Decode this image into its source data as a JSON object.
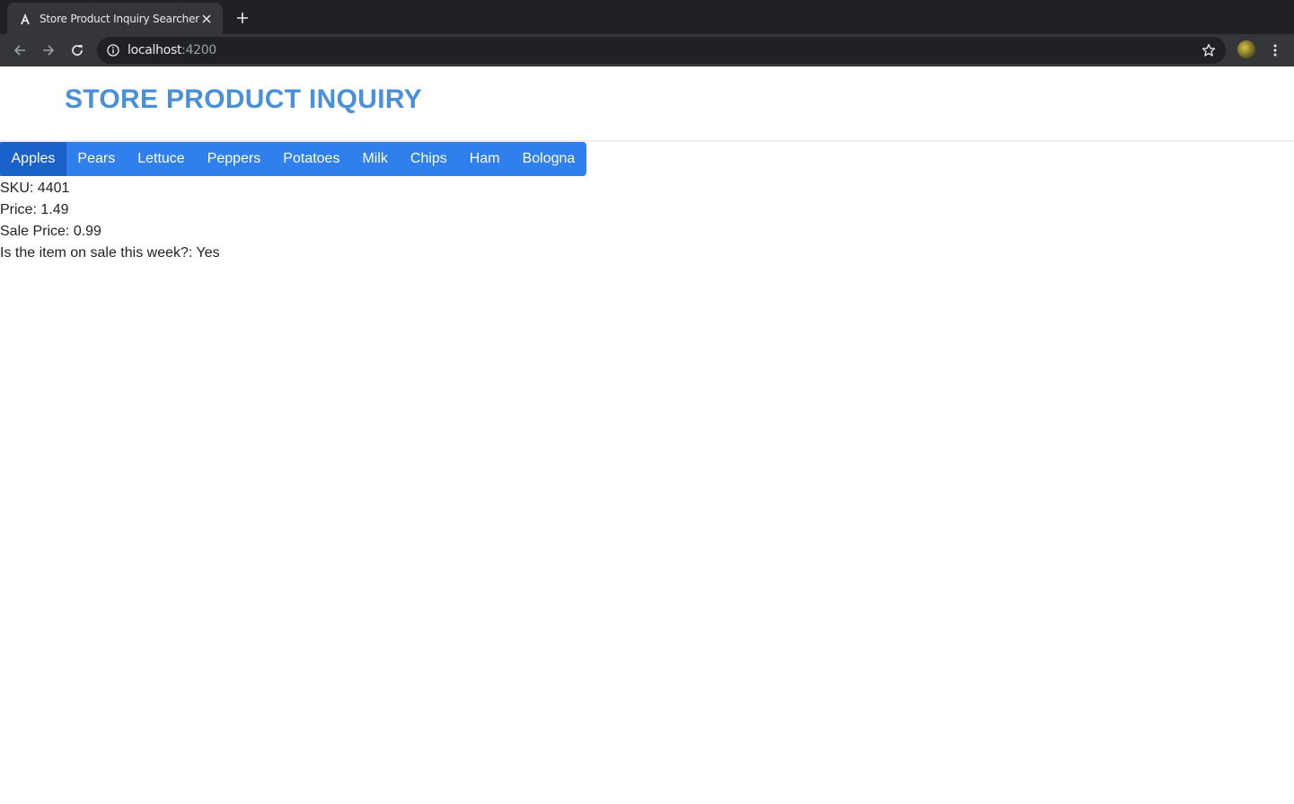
{
  "browser": {
    "tab_title": "Store Product Inquiry Searcher",
    "url_host": "localhost",
    "url_port": ":4200",
    "icons": [
      "angular-icon",
      "close-icon",
      "plus-icon",
      "back-icon",
      "forward-icon",
      "reload-icon",
      "info-icon",
      "star-icon",
      "menu-icon"
    ]
  },
  "page": {
    "title": "STORE PRODUCT INQUIRY",
    "accent_color": "#4a90d9",
    "tab_color": "#2f80ed",
    "active_tab_color": "#1a62c9"
  },
  "tabs": [
    {
      "label": "Apples",
      "active": true
    },
    {
      "label": "Pears"
    },
    {
      "label": "Lettuce"
    },
    {
      "label": "Peppers"
    },
    {
      "label": "Potatoes"
    },
    {
      "label": "Milk"
    },
    {
      "label": "Chips"
    },
    {
      "label": "Ham"
    },
    {
      "label": "Bologna"
    }
  ],
  "details": {
    "sku": "SKU: 4401",
    "price": "Price: 1.49",
    "sale_price": "Sale Price: 0.99",
    "on_sale": "Is the item on sale this week?: Yes"
  }
}
